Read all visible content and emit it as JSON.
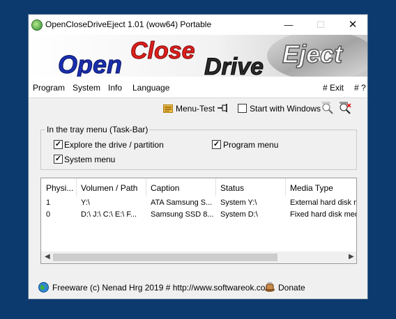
{
  "window": {
    "title": "OpenCloseDriveEject 1.01  (wow64) Portable"
  },
  "banner": {
    "word1": "Open",
    "word2": "Close",
    "word3": "Drive",
    "word4": "Eject"
  },
  "menu": {
    "items": [
      "Program",
      "System",
      "Info",
      "Language"
    ],
    "exit": "# Exit",
    "help": "# ?"
  },
  "toolbar": {
    "menu_test": "Menu-Test",
    "start_with_windows": "Start with Windows",
    "start_with_windows_checked": false
  },
  "tray": {
    "title": "In the tray menu (Task-Bar)",
    "explore": {
      "label": "Explore the drive / partition",
      "checked": true
    },
    "program": {
      "label": "Program menu",
      "checked": true
    },
    "system": {
      "label": "System menu",
      "checked": true
    }
  },
  "table": {
    "columns": [
      "Physi...",
      "Volumen / Path",
      "Caption",
      "Status",
      "Media Type"
    ],
    "rows": [
      [
        "1",
        "Y:\\",
        "ATA Samsung S...",
        "System Y:\\",
        "External hard disk m"
      ],
      [
        "0",
        "D:\\ J:\\ C:\\ E:\\ F...",
        "Samsung SSD 8...",
        "System D:\\",
        "Fixed hard disk medi"
      ]
    ]
  },
  "footer": {
    "freeware": "Freeware (c) Nenad Hrg 2019 # http://www.softwareok.com",
    "donate": "Donate"
  },
  "colors": {
    "desktop": "#0d3a6e",
    "banner_red": "#e0201c",
    "banner_blue": "#1a2fb0"
  }
}
